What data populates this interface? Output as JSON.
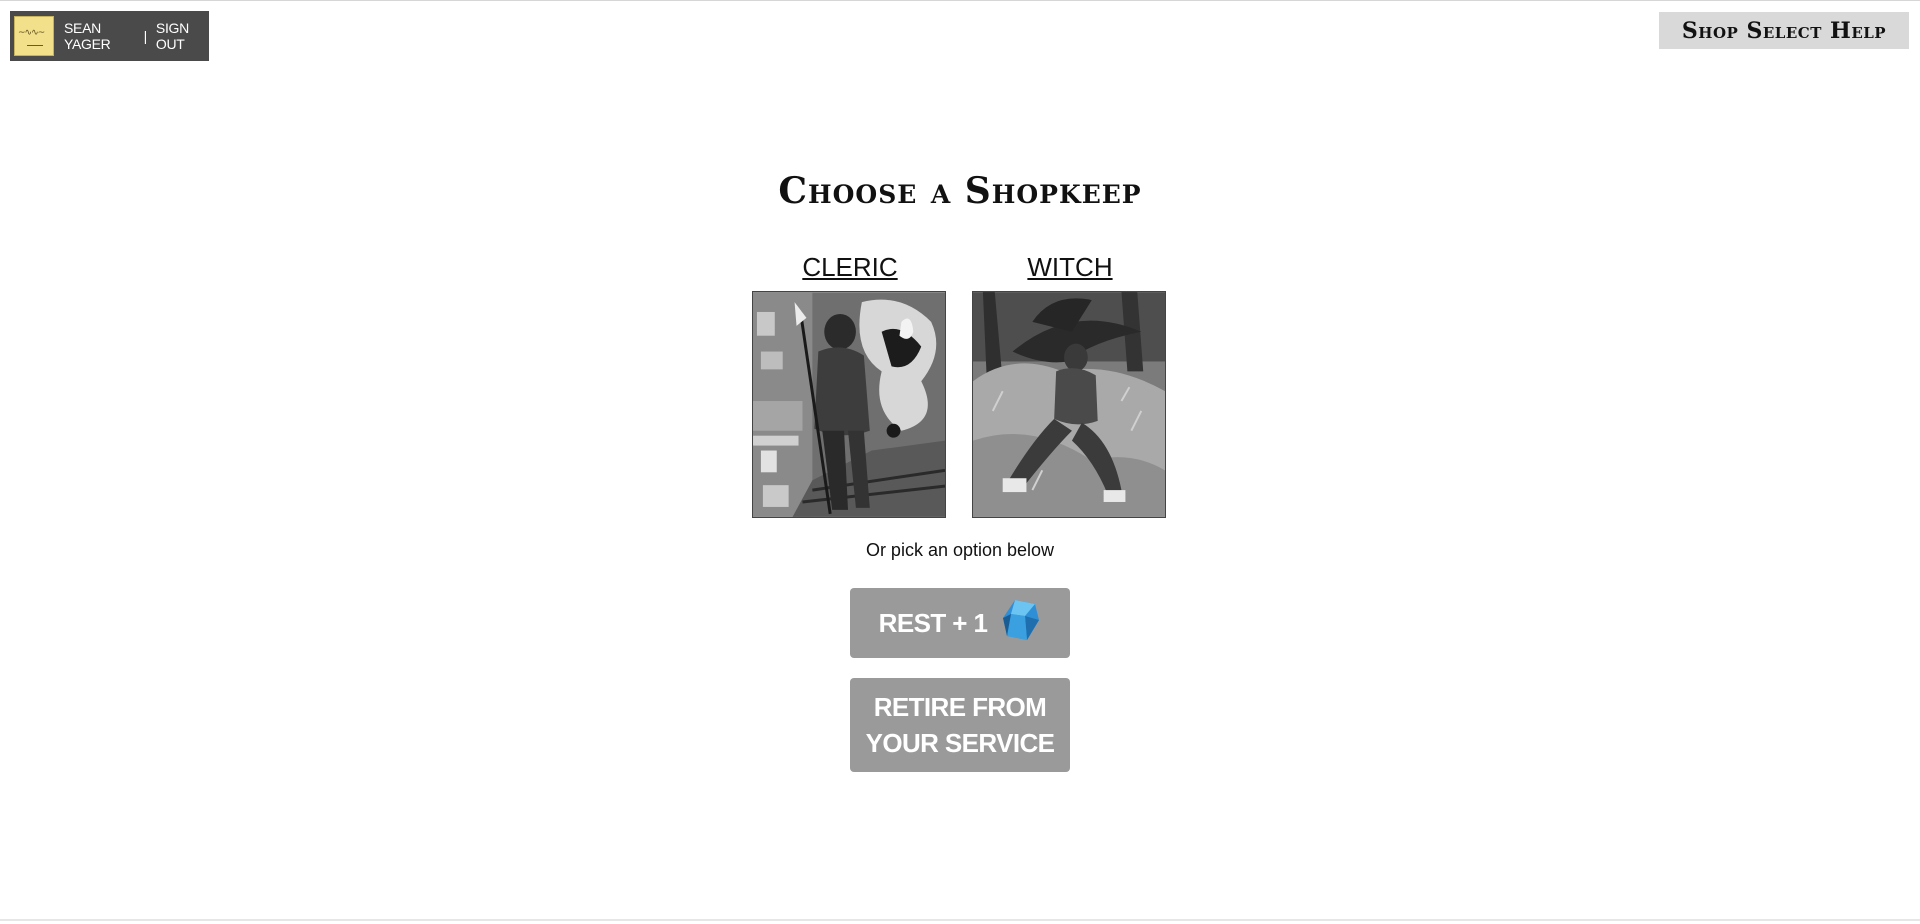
{
  "user": {
    "name": "SEAN YAGER",
    "separator": "|",
    "sign_out_label": "SIGN OUT",
    "avatar_icon": "user-avatar-icon"
  },
  "help": {
    "label": "Shop Select Help"
  },
  "title": "Choose a Shopkeep",
  "shopkeeps": [
    {
      "name": "CLERIC",
      "portrait_icon": "cleric-portrait"
    },
    {
      "name": "WITCH",
      "portrait_icon": "witch-portrait"
    }
  ],
  "hint": "Or pick an option below",
  "actions": {
    "rest_label": "REST + 1",
    "rest_icon": "blue-gem-icon",
    "retire_label": "RETIRE FROM YOUR SERVICE"
  },
  "colors": {
    "badge_bg": "#4a4a4a",
    "help_bg": "#d9d9d9",
    "button_bg": "#9a9a9a",
    "gem": "#3aa0e0"
  }
}
